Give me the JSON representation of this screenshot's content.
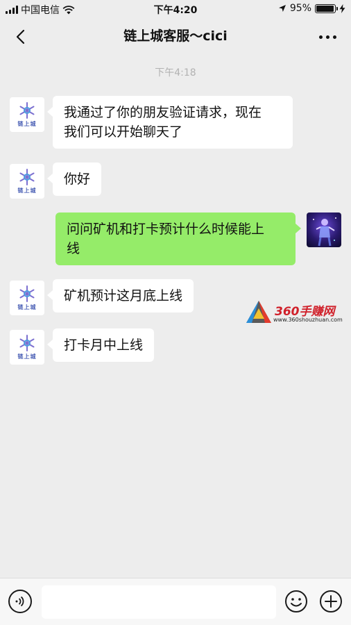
{
  "status_bar": {
    "carrier": "中国电信",
    "time": "下午4:20",
    "battery": "95%",
    "battery_level": 0.95,
    "icons": [
      "signal-icon",
      "wifi-icon",
      "location-icon",
      "battery-icon",
      "charging-icon"
    ]
  },
  "nav": {
    "title": "链上城客服～cici",
    "back_icon": "chevron-left-icon",
    "more_icon": "more-dots-icon"
  },
  "chat": {
    "timestamp": "下午4:18",
    "contact_avatar_text": "链上城",
    "messages": [
      {
        "side": "in",
        "lines": [
          "我通过了你的朋友验证请求，现在",
          "我们可以开始聊天了"
        ]
      },
      {
        "side": "in",
        "lines": [
          "你好"
        ]
      },
      {
        "side": "out",
        "lines": [
          "问问矿机和打卡预计什么时候能上",
          "线"
        ]
      },
      {
        "side": "in",
        "lines": [
          "矿机预计这月底上线"
        ]
      },
      {
        "side": "in",
        "lines": [
          "打卡月中上线"
        ]
      }
    ]
  },
  "watermark": {
    "brand": "360手赚网",
    "url": "www.360shouzhuan.com"
  },
  "input_bar": {
    "value": "",
    "placeholder": "",
    "icons": [
      "voice-icon",
      "emoji-icon",
      "plus-icon"
    ]
  },
  "colors": {
    "background": "#ededed",
    "outgoing_bubble": "#95ec69",
    "incoming_bubble": "#ffffff",
    "timestamp": "#b2b2b2"
  }
}
